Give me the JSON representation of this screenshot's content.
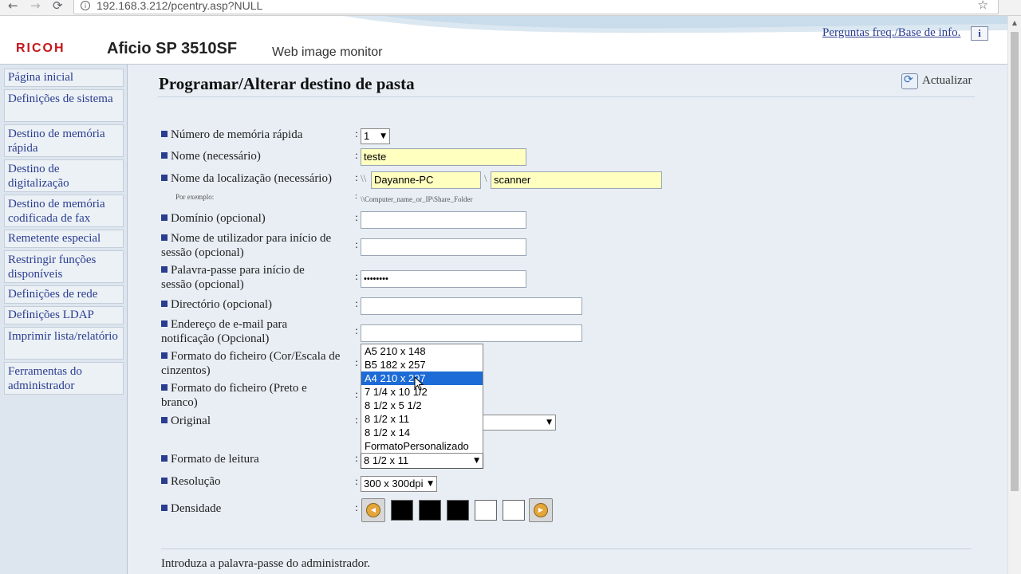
{
  "browser": {
    "back": "←",
    "forward": "→",
    "reload": "⟳",
    "url": "192.168.3.212/pcentry.asp?NULL",
    "info": "i",
    "star": "☆"
  },
  "header": {
    "logo": "RICOH",
    "model": "Aficio SP 3510SF",
    "subtitle": "Web image monitor",
    "faq_link": "Perguntas freq./Base de info.",
    "help_icon": "i"
  },
  "sidebar": {
    "items": [
      {
        "label": "Página inicial"
      },
      {
        "label": "Definições de sistema"
      },
      {
        "label": "Destino de memória rápida"
      },
      {
        "label": "Destino de digitalização"
      },
      {
        "label": "Destino de memória codificada de fax"
      },
      {
        "label": "Remetente especial"
      },
      {
        "label": "Restringir funções disponíveis"
      },
      {
        "label": "Definições de rede"
      },
      {
        "label": "Definições LDAP"
      },
      {
        "label": "Imprimir lista/relatório"
      },
      {
        "label": "Ferramentas do administrador"
      }
    ]
  },
  "main": {
    "title": "Programar/Alterar destino de pasta",
    "refresh_label": "Actualizar",
    "colon": ":",
    "fields": {
      "quick_memory": {
        "label": "Número de memória rápida",
        "value": "1"
      },
      "name": {
        "label": "Nome (necessário)",
        "value": "teste"
      },
      "location": {
        "label": "Nome da localização (necessário)",
        "prefix": "\\\\",
        "separator": "\\",
        "host": "Dayanne-PC",
        "share": "scanner",
        "example_label": "Por exemplo:",
        "example_value": "\\\\Computer_name_or_IP\\Share_Folder"
      },
      "domain": {
        "label": "Domínio (opcional)",
        "value": ""
      },
      "login_user": {
        "label": "Nome de utilizador para início de sessão (opcional)",
        "value": ""
      },
      "login_password": {
        "label": "Palavra-passe para início de sessão (opcional)",
        "value": "••••••••"
      },
      "directory": {
        "label": "Directório (opcional)",
        "value": ""
      },
      "email": {
        "label": "Endereço de e-mail para notificação (Opcional)",
        "value": ""
      },
      "format_color": {
        "label": "Formato do ficheiro (Cor/Escala de cinzentos)"
      },
      "format_bw": {
        "label": "Formato do ficheiro (Preto e branco)"
      },
      "original": {
        "label": "Original",
        "value": ""
      },
      "scan_size": {
        "label": "Formato de leitura",
        "value": "8 1/2 x 11",
        "options": [
          "A5 210 x 148",
          "B5 182 x 257",
          "A4 210 x 297",
          "7 1/4 x 10 1/2",
          "8 1/2 x 5 1/2",
          "8 1/2 x 11",
          "8 1/2 x 14",
          "FormatoPersonalizado"
        ],
        "highlighted": "A4 210 x 297"
      },
      "resolution": {
        "label": "Resolução",
        "value": "300 x 300dpi"
      },
      "density": {
        "label": "Densidade",
        "level": 3,
        "of": 5,
        "left": "◀",
        "right": "▶"
      }
    },
    "admin_note": "Introduza a palavra-passe do administrador."
  },
  "ui": {
    "arrow": "▼",
    "refresh_glyph": "⟳",
    "scroll_up": "▲"
  },
  "colors": {
    "accent": "#2a3d8f",
    "ricoh_red": "#c4161c",
    "required_field": "#ffffc0",
    "highlight": "#1c6bd6"
  }
}
